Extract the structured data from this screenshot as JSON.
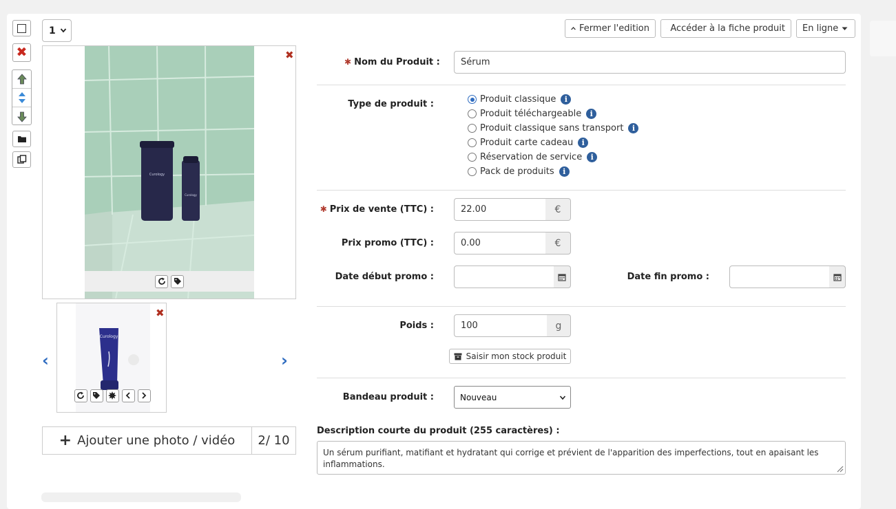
{
  "toolbar": {
    "quantity_value": "1",
    "close_edit_label": "Fermer l'edition",
    "access_sheet_label": "Accéder à la fiche produit",
    "status_label": "En ligne"
  },
  "gallery": {
    "photo_count": "2/ 10",
    "add_photo_label": "Ajouter une photo / vidéo",
    "product_brand": "Curology"
  },
  "form": {
    "product_name_label": "Nom du Produit :",
    "product_name_value": "Sérum",
    "product_type_label": "Type de produit :",
    "product_types": [
      {
        "label": "Produit classique",
        "selected": true
      },
      {
        "label": "Produit téléchargeable",
        "selected": false
      },
      {
        "label": "Produit classique sans transport",
        "selected": false
      },
      {
        "label": "Produit carte cadeau",
        "selected": false
      },
      {
        "label": "Réservation de service",
        "selected": false
      },
      {
        "label": "Pack de produits",
        "selected": false
      }
    ],
    "sale_price_label": "Prix de vente (TTC) :",
    "sale_price_value": "22.00",
    "currency": "€",
    "promo_price_label": "Prix promo (TTC) :",
    "promo_price_value": "0.00",
    "promo_start_label": "Date début promo :",
    "promo_end_label": "Date fin promo :",
    "weight_label": "Poids :",
    "weight_value": "100",
    "weight_unit": "g",
    "stock_button_label": "Saisir mon stock produit",
    "banner_label": "Bandeau produit :",
    "banner_value": "Nouveau",
    "short_desc_label": "Description courte du produit (255 caractères) :",
    "short_desc_value": "Un sérum purifiant, matifiant et hydratant qui corrige et prévient de l'apparition des imperfections, tout en apaisant les inflammations."
  },
  "colors": {
    "accent_blue": "#2f6cc0",
    "delete_red": "#b03020",
    "required_red": "#b03a2e"
  }
}
